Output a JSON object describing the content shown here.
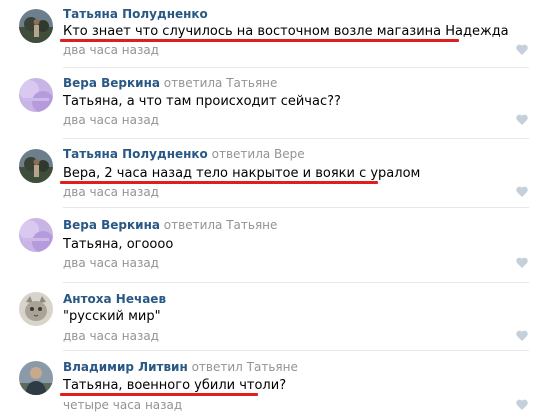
{
  "comments": [
    {
      "author": "Татьяна Полудненко",
      "replied": "",
      "text": "Кто знает что случилось на восточном возле магазина Надежда",
      "time": "два часа назад",
      "avatar": "avatar-photo-icon",
      "underlined": true
    },
    {
      "author": "Вера Веркина",
      "replied": "ответила Татьяне",
      "text": "Татьяна, а что там происходит сейчас??",
      "time": "два часа назад",
      "avatar": "avatar-purple-icon",
      "underlined": false
    },
    {
      "author": "Татьяна Полудненко",
      "replied": "ответила Вере",
      "text": "Вера, 2 часа назад тело накрытое и вояки с уралом",
      "time": "два часа назад",
      "avatar": "avatar-photo-icon",
      "underlined": true
    },
    {
      "author": "Вера Веркина",
      "replied": "ответила Татьяне",
      "text": "Татьяна, огоооо",
      "time": "два часа назад",
      "avatar": "avatar-purple-icon",
      "underlined": false
    },
    {
      "author": "Антоха Нечаев",
      "replied": "",
      "text": "\"русский мир\"",
      "time": "два часа назад",
      "avatar": "avatar-cat-icon",
      "underlined": false
    },
    {
      "author": "Владимир Литвин",
      "replied": "ответил Татьяне",
      "text": "Татьяна, военного убили чтоли?",
      "time": "четыре часа назад",
      "avatar": "avatar-man-icon",
      "underlined": true
    }
  ],
  "colors": {
    "author": "#2a5885",
    "muted": "#939393",
    "underline": "#e01e1e",
    "divider": "#e7e8ec",
    "like": "#c5d0db"
  },
  "icons": {
    "like": "heart-icon"
  }
}
